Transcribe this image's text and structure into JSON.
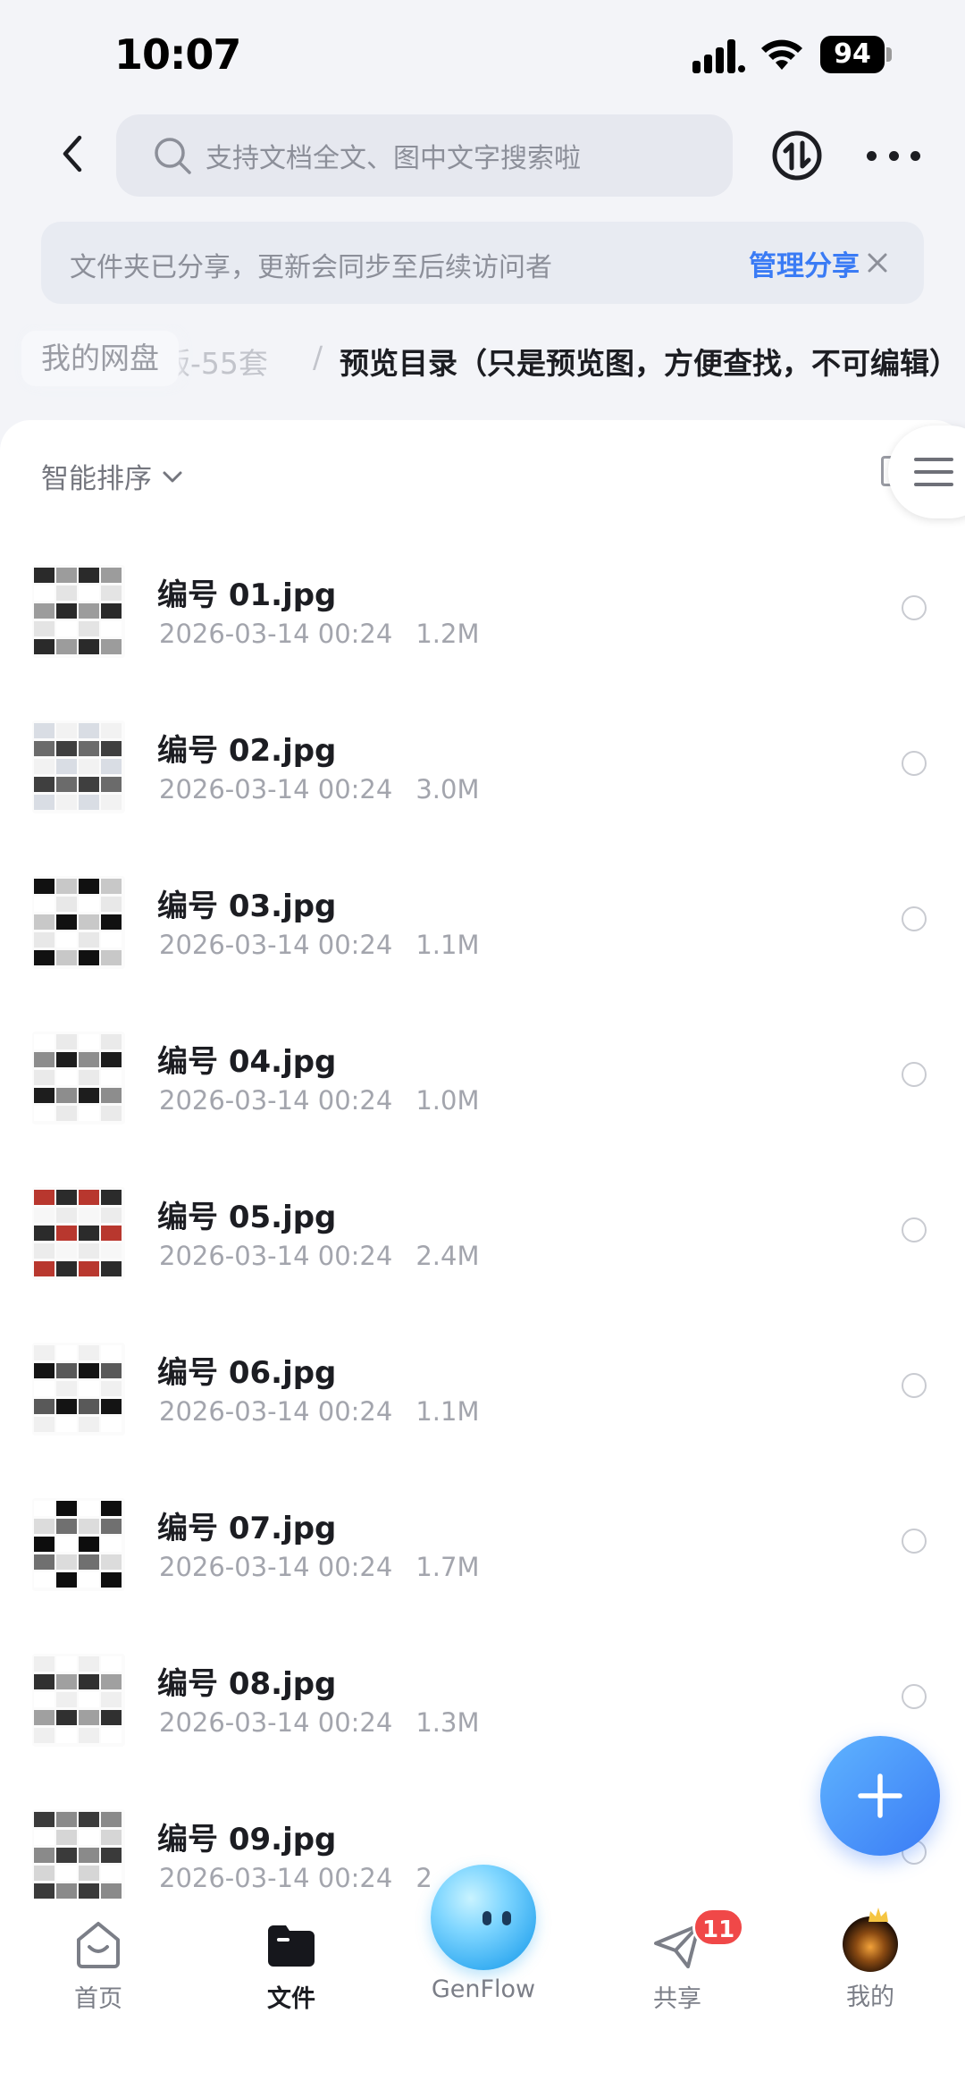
{
  "status_bar": {
    "time": "10:07",
    "battery": "94"
  },
  "header": {
    "search_placeholder": "支持文档全文、图中文字搜索啦"
  },
  "share_banner": {
    "text": "文件夹已分享，更新会同步至后续访问者",
    "manage_label": "管理分享"
  },
  "breadcrumb": {
    "root": "我的网盘",
    "middle": "版-55套",
    "separator": "/",
    "current": "预览目录（只是预览图，方便查找，不可编辑）"
  },
  "toolbar": {
    "sort_label": "智能排序"
  },
  "files": [
    {
      "name": "编号 01.jpg",
      "date": "2026-03-14 00:24",
      "size": "1.2M"
    },
    {
      "name": "编号 02.jpg",
      "date": "2026-03-14 00:24",
      "size": "3.0M"
    },
    {
      "name": "编号 03.jpg",
      "date": "2026-03-14 00:24",
      "size": "1.1M"
    },
    {
      "name": "编号 04.jpg",
      "date": "2026-03-14 00:24",
      "size": "1.0M"
    },
    {
      "name": "编号 05.jpg",
      "date": "2026-03-14 00:24",
      "size": "2.4M"
    },
    {
      "name": "编号 06.jpg",
      "date": "2026-03-14 00:24",
      "size": "1.1M"
    },
    {
      "name": "编号 07.jpg",
      "date": "2026-03-14 00:24",
      "size": "1.7M"
    },
    {
      "name": "编号 08.jpg",
      "date": "2026-03-14 00:24",
      "size": "1.3M"
    },
    {
      "name": "编号 09.jpg",
      "date": "2026-03-14 00:24",
      "size": "2"
    }
  ],
  "tab_bar": {
    "home": "首页",
    "files": "文件",
    "genflow": "GenFlow",
    "share": "共享",
    "share_badge": "11",
    "mine": "我的"
  },
  "colors": {
    "accent": "#3a7bf5",
    "badge": "#f04848",
    "fab": "#4d98f8"
  }
}
